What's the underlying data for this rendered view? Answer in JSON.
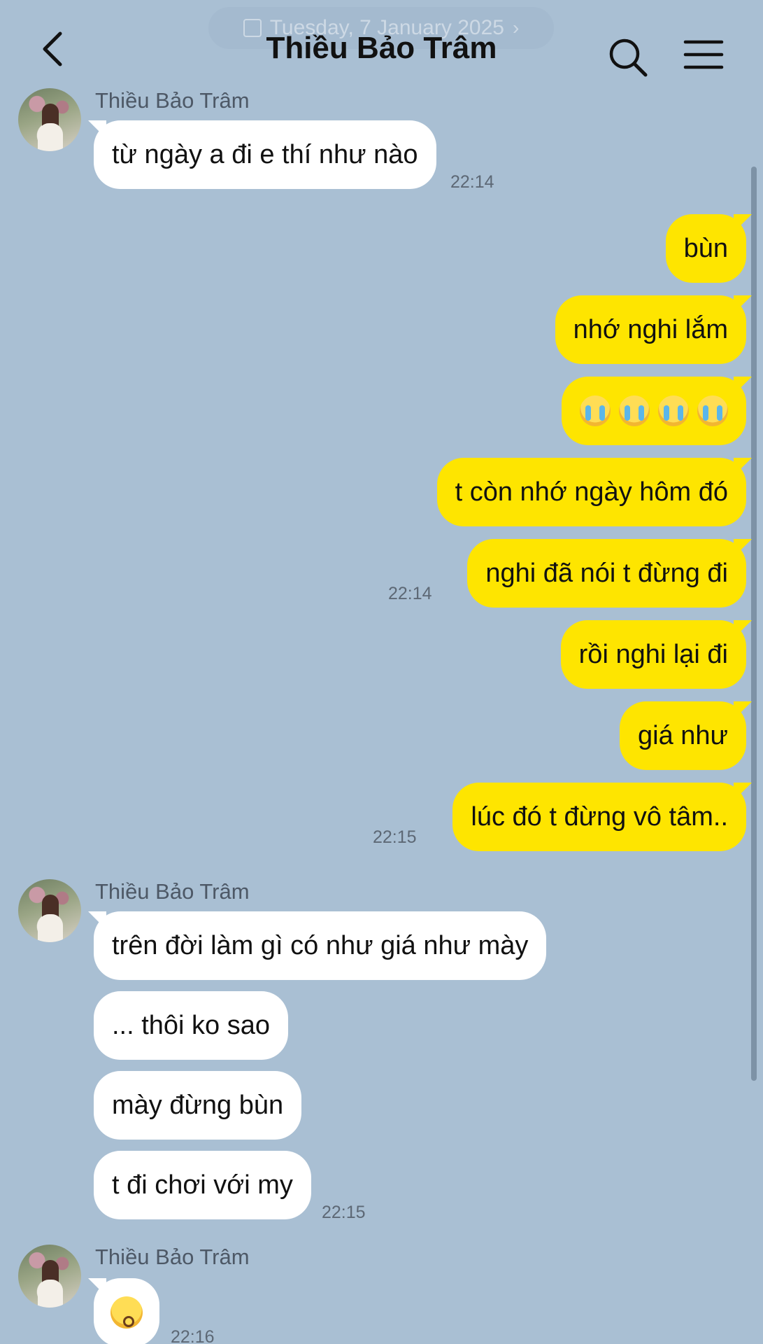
{
  "header": {
    "date_label": "Tuesday, 7 January 2025",
    "date_chevron": "›",
    "title": "Thiều Bảo Trâm",
    "icons": {
      "back": "chevron-left-icon",
      "search": "search-icon",
      "menu": "hamburger-menu-icon"
    }
  },
  "colors": {
    "background": "#a9bfd3",
    "incoming_bubble": "#ffffff",
    "outgoing_bubble": "#fee500"
  },
  "messages": [
    {
      "direction": "in",
      "sender": "Thiều Bảo Trâm",
      "text": "từ ngày a đi e thí như nào",
      "time": "22:14"
    },
    {
      "direction": "out",
      "text": "bùn"
    },
    {
      "direction": "out",
      "text": "nhớ nghi lắm"
    },
    {
      "direction": "out",
      "emoji": "loudly-crying-face x4"
    },
    {
      "direction": "out",
      "text": "t còn nhớ ngày hôm đó"
    },
    {
      "direction": "out",
      "text": "nghi đã nói t đừng đi",
      "time": "22:14"
    },
    {
      "direction": "out",
      "text": "rồi nghi lại đi"
    },
    {
      "direction": "out",
      "text": "giá như"
    },
    {
      "direction": "out",
      "text": "lúc đó t đừng vô tâm..",
      "time": "22:15"
    },
    {
      "direction": "in",
      "sender": "Thiều Bảo Trâm",
      "text": "trên đời làm gì có như giá như mày"
    },
    {
      "direction": "in",
      "text": "... thôi ko sao"
    },
    {
      "direction": "in",
      "text": "mày đừng bùn"
    },
    {
      "direction": "in",
      "text": "t đi chơi với my",
      "time": "22:15"
    },
    {
      "direction": "in",
      "sender": "Thiều Bảo Trâm",
      "emoji": "kissing-face",
      "time": "22:16"
    }
  ]
}
